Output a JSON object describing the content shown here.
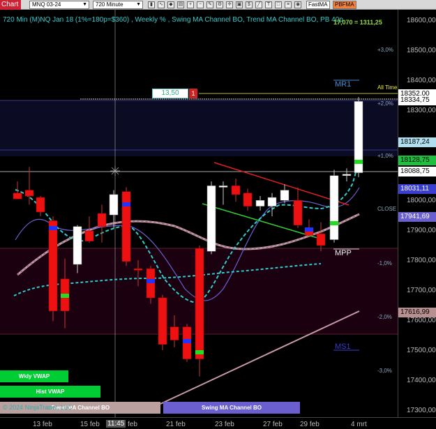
{
  "toolbar": {
    "chart_label": "Chart",
    "instrument": "MNQ 03-24",
    "interval": "720 Minute",
    "fastma": "FastMA",
    "pbfma": "PBFMA"
  },
  "chart_title": "720 Min (M)NQ Jan 18 (1%=180p=$360) , Weekly % , Swing MA Channel BO, Trend MA Channel BO, PB 40p",
  "range_readout": "17,070 = 1311,25",
  "price_ticks": [
    "18600,00",
    "18500,00",
    "18400,00",
    "18300,00",
    "18200,00",
    "18100,00",
    "18000,00",
    "17900,00",
    "17800,00",
    "17700,00",
    "17600,00",
    "17500,00",
    "17400,00",
    "17300,00"
  ],
  "price_boxes": [
    {
      "text": "18352,00",
      "bg": "#ffffff",
      "fg": "#000000"
    },
    {
      "text": "18334,75",
      "bg": "#ffffff",
      "fg": "#000000"
    },
    {
      "text": "18187,24",
      "bg": "#b0e0f0",
      "fg": "#000000"
    },
    {
      "text": "18128,75",
      "bg": "#1fbf3f",
      "fg": "#000000"
    },
    {
      "text": "18088,75",
      "bg": "#ffffff",
      "fg": "#000000"
    },
    {
      "text": "18031,11",
      "bg": "#3b3fd0",
      "fg": "#ffffff"
    },
    {
      "text": "17941,69",
      "bg": "#6b5fd0",
      "fg": "#ffffff"
    },
    {
      "text": "17616,99",
      "bg": "#b89090",
      "fg": "#000000"
    }
  ],
  "pct_labels": [
    "+3,0%",
    "+2,0%",
    "+1,0%",
    "CLOSE",
    "-1,0%",
    "-2,0%",
    "-3,0%"
  ],
  "level_labels": {
    "mr1": "MR1",
    "mpp": "MPP",
    "ms1": "MS1",
    "all_time": "All Time"
  },
  "order_box": {
    "value": "13,50",
    "qty": "1"
  },
  "x_labels": [
    "13 feb",
    "15 feb",
    "11:45",
    "feb",
    "21 feb",
    "23 feb",
    "27 feb",
    "29 feb",
    "4 mrt"
  ],
  "copyright": "© 2024 NinjaTrader, LLC",
  "bottom_bars": [
    {
      "text": "Wkly VWAP",
      "color": "#00cc33"
    },
    {
      "text": "Hist VWAP",
      "color": "#00cc33"
    },
    {
      "text": "Trend MA Channel BO",
      "color": "#bba0a0"
    },
    {
      "text": "Swing MA Channel BO",
      "color": "#6b5fd0"
    }
  ],
  "chart_data": {
    "type": "candlestick",
    "y_range": [
      17250,
      18650
    ],
    "candles": [
      {
        "o": 18020,
        "h": 18060,
        "l": 18000,
        "c": 18000
      },
      {
        "o": 18030,
        "h": 18110,
        "l": 17980,
        "c": 18010
      },
      {
        "o": 18005,
        "h": 18010,
        "l": 17940,
        "c": 17955
      },
      {
        "o": 17925,
        "h": 17940,
        "l": 17580,
        "c": 17615
      },
      {
        "o": 17725,
        "h": 17795,
        "l": 17555,
        "c": 17615
      },
      {
        "o": 17775,
        "h": 17910,
        "l": 17745,
        "c": 17905
      },
      {
        "o": 17890,
        "h": 17940,
        "l": 17850,
        "c": 17855
      },
      {
        "o": 17950,
        "h": 17980,
        "l": 17850,
        "c": 17905
      },
      {
        "o": 17945,
        "h": 18030,
        "l": 17900,
        "c": 18015
      },
      {
        "o": 18025,
        "h": 18040,
        "l": 17770,
        "c": 17785
      },
      {
        "o": 17760,
        "h": 17790,
        "l": 17700,
        "c": 17755
      },
      {
        "o": 17760,
        "h": 17770,
        "l": 17640,
        "c": 17660
      },
      {
        "o": 17660,
        "h": 17670,
        "l": 17480,
        "c": 17500
      },
      {
        "o": 17560,
        "h": 17600,
        "l": 17490,
        "c": 17515
      },
      {
        "o": 17560,
        "h": 17570,
        "l": 17440,
        "c": 17450
      },
      {
        "o": 17830,
        "h": 17840,
        "l": 17390,
        "c": 17450
      },
      {
        "o": 17820,
        "h": 18060,
        "l": 17810,
        "c": 18045
      },
      {
        "o": 18040,
        "h": 18060,
        "l": 17980,
        "c": 18045
      },
      {
        "o": 18045,
        "h": 18070,
        "l": 17990,
        "c": 18015
      },
      {
        "o": 18020,
        "h": 18035,
        "l": 17960,
        "c": 17975
      },
      {
        "o": 17975,
        "h": 18010,
        "l": 17960,
        "c": 17995
      },
      {
        "o": 17975,
        "h": 18020,
        "l": 17940,
        "c": 18005
      },
      {
        "o": 17995,
        "h": 18050,
        "l": 17985,
        "c": 18030
      },
      {
        "o": 17995,
        "h": 18040,
        "l": 17900,
        "c": 17910
      },
      {
        "o": 17900,
        "h": 17930,
        "l": 17870,
        "c": 17875
      },
      {
        "o": 17880,
        "h": 17920,
        "l": 17820,
        "c": 17840
      },
      {
        "o": 17860,
        "h": 18100,
        "l": 17850,
        "c": 18080
      },
      {
        "o": 18080,
        "h": 18105,
        "l": 18060,
        "c": 18085
      },
      {
        "o": 18090,
        "h": 18350,
        "l": 18075,
        "c": 18335
      }
    ]
  }
}
